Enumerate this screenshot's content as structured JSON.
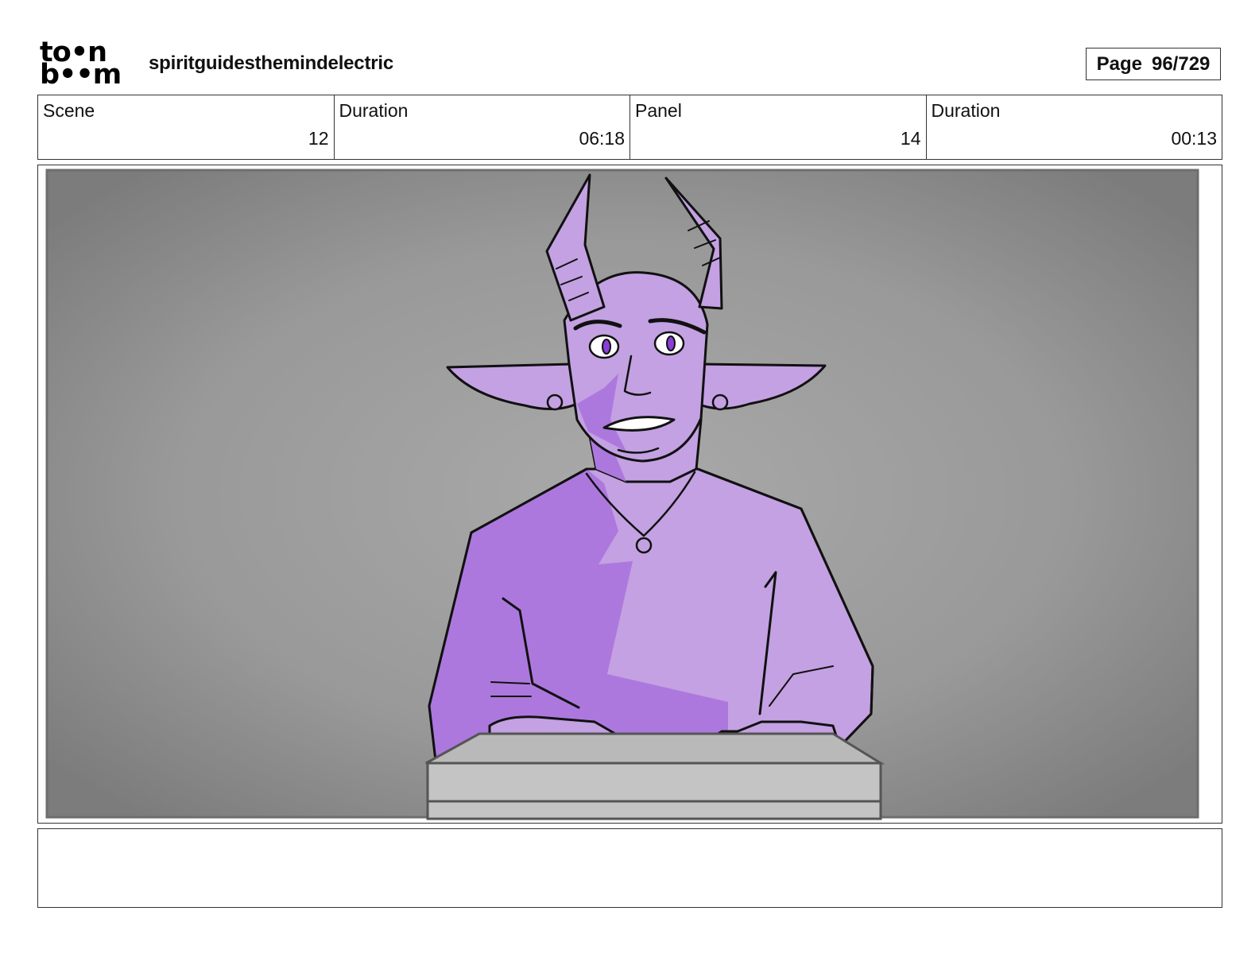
{
  "header": {
    "logo_line1": "to•n",
    "logo_line2": "b••m",
    "project_title": "spiritguidesthemindelectric",
    "page_label": "Page",
    "page_value": "96/729"
  },
  "info": {
    "scene_label": "Scene",
    "scene_value": "12",
    "scene_duration_label": "Duration",
    "scene_duration_value": "06:18",
    "panel_label": "Panel",
    "panel_value": "14",
    "panel_duration_label": "Duration",
    "panel_duration_value": "00:13"
  },
  "colors": {
    "skin_light": "#c3a1e2",
    "skin_shadow": "#ad78de",
    "background_grey": "#9a9a9a",
    "desk_grey": "#c0c0c0"
  },
  "notes": {
    "text": ""
  }
}
